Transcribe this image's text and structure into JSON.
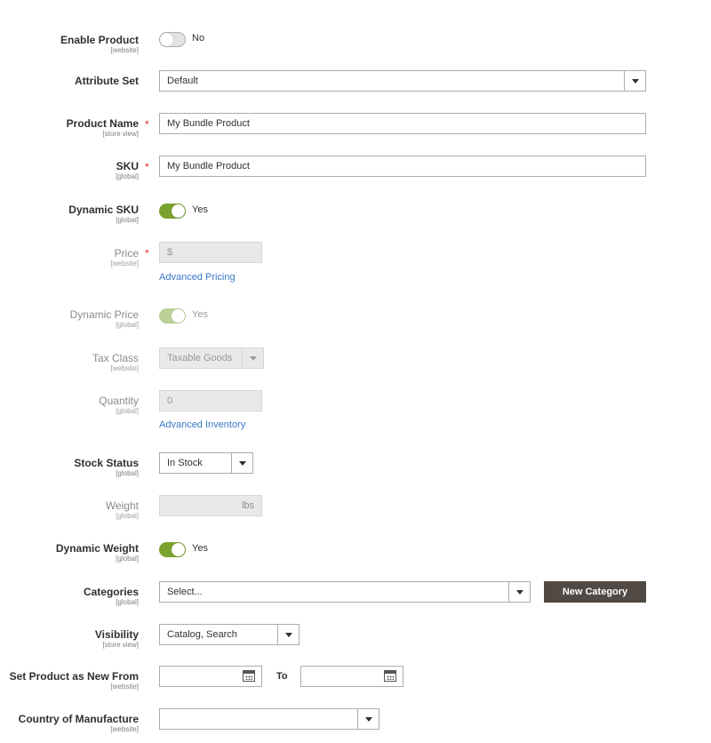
{
  "fields": {
    "enable_product": {
      "label": "Enable Product",
      "scope": "[website]",
      "value_text": "No",
      "checked": false
    },
    "attribute_set": {
      "label": "Attribute Set",
      "value": "Default"
    },
    "product_name": {
      "label": "Product Name",
      "scope": "[store view]",
      "required": "*",
      "value": "My Bundle Product"
    },
    "sku": {
      "label": "SKU",
      "scope": "[global]",
      "required": "*",
      "value": "My Bundle Product"
    },
    "dynamic_sku": {
      "label": "Dynamic SKU",
      "scope": "[global]",
      "value_text": "Yes",
      "checked": true
    },
    "price": {
      "label": "Price",
      "scope": "[website]",
      "required": "*",
      "prefix": "$",
      "link": "Advanced Pricing"
    },
    "dynamic_price": {
      "label": "Dynamic Price",
      "scope": "[global]",
      "value_text": "Yes",
      "checked": true
    },
    "tax_class": {
      "label": "Tax Class",
      "scope": "[website]",
      "value": "Taxable Goods"
    },
    "quantity": {
      "label": "Quantity",
      "scope": "[global]",
      "value": "0",
      "link": "Advanced Inventory"
    },
    "stock_status": {
      "label": "Stock Status",
      "scope": "[global]",
      "value": "In Stock"
    },
    "weight": {
      "label": "Weight",
      "scope": "[global]",
      "suffix": "lbs"
    },
    "dynamic_weight": {
      "label": "Dynamic Weight",
      "scope": "[global]",
      "value_text": "Yes",
      "checked": true
    },
    "categories": {
      "label": "Categories",
      "scope": "[global]",
      "placeholder": "Select...",
      "button": "New Category"
    },
    "visibility": {
      "label": "Visibility",
      "scope": "[store view]",
      "value": "Catalog, Search"
    },
    "new_from": {
      "label": "Set Product as New From",
      "scope": "[website]",
      "to_label": "To"
    },
    "country": {
      "label": "Country of Manufacture",
      "scope": "[website]",
      "value": ""
    }
  },
  "colors": {
    "toggle_on": "#79a22e",
    "required": "#e22626",
    "link": "#3a78c8",
    "button_dark": "#514943"
  },
  "icons": {
    "calendar": "calendar-icon",
    "dropdown": "chevron-down-icon"
  }
}
